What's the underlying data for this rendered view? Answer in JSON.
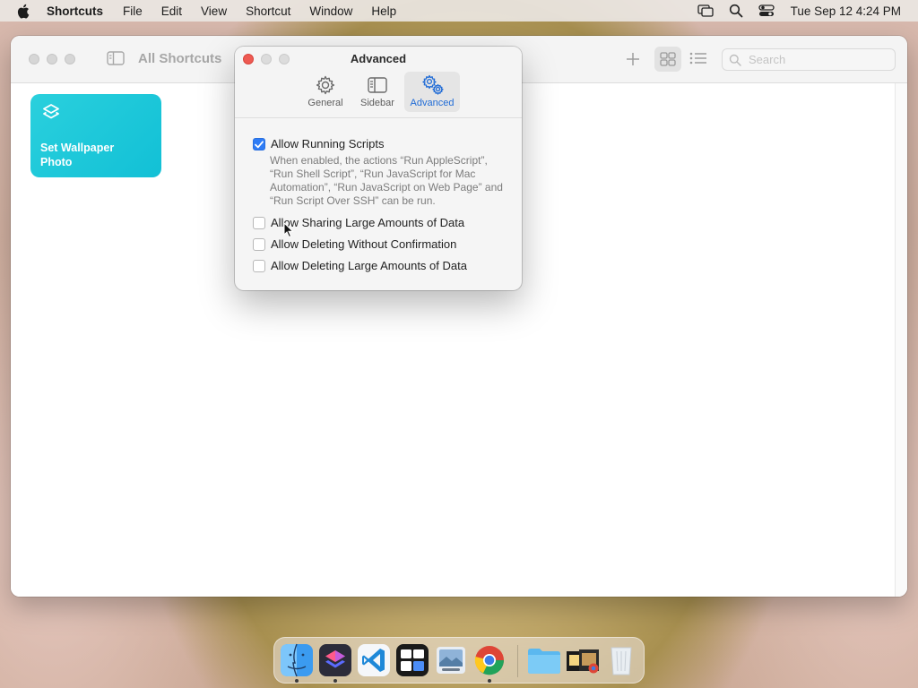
{
  "menubar": {
    "app_name": "Shortcuts",
    "menus": [
      "File",
      "Edit",
      "View",
      "Shortcut",
      "Window",
      "Help"
    ],
    "clock": "Tue Sep 12  4:24 PM",
    "status_icons": [
      "screen-mirroring-icon",
      "spotlight-search-icon",
      "control-center-icon"
    ]
  },
  "window": {
    "title": "All Shortcuts",
    "search_placeholder": "Search",
    "shortcuts": [
      {
        "label": "Set Wallpaper Photo",
        "color": "#1cc6d9",
        "icon": "layers-icon"
      }
    ]
  },
  "preferences": {
    "title": "Advanced",
    "tabs": [
      {
        "label": "General",
        "icon": "gear-icon",
        "selected": false
      },
      {
        "label": "Sidebar",
        "icon": "sidebar-icon",
        "selected": false
      },
      {
        "label": "Advanced",
        "icon": "gears-icon",
        "selected": true
      }
    ],
    "options": [
      {
        "label": "Allow Running Scripts",
        "checked": true
      },
      {
        "label": "Allow Sharing Large Amounts of Data",
        "checked": false
      },
      {
        "label": "Allow Deleting Without Confirmation",
        "checked": false
      },
      {
        "label": "Allow Deleting Large Amounts of Data",
        "checked": false
      }
    ],
    "running_scripts_description": "When enabled, the actions “Run AppleScript”, “Run Shell Script”, “Run JavaScript for Mac Automation”, “Run JavaScript on Web Page” and “Run Script Over SSH” can be run."
  },
  "dock": {
    "apps": [
      {
        "name": "finder-icon",
        "running": true
      },
      {
        "name": "shortcuts-icon",
        "running": true
      },
      {
        "name": "vscode-icon",
        "running": false
      },
      {
        "name": "window-manager-icon",
        "running": false
      },
      {
        "name": "preview-icon",
        "running": false
      },
      {
        "name": "chrome-icon",
        "running": true
      },
      {
        "name": "folder-icon",
        "running": false
      },
      {
        "name": "recent-items-icon",
        "running": false
      },
      {
        "name": "trash-icon",
        "running": false
      }
    ]
  },
  "colors": {
    "accent": "#2e7cf6",
    "close_button": "#ee5a52",
    "tile": "#1cc6d9"
  }
}
